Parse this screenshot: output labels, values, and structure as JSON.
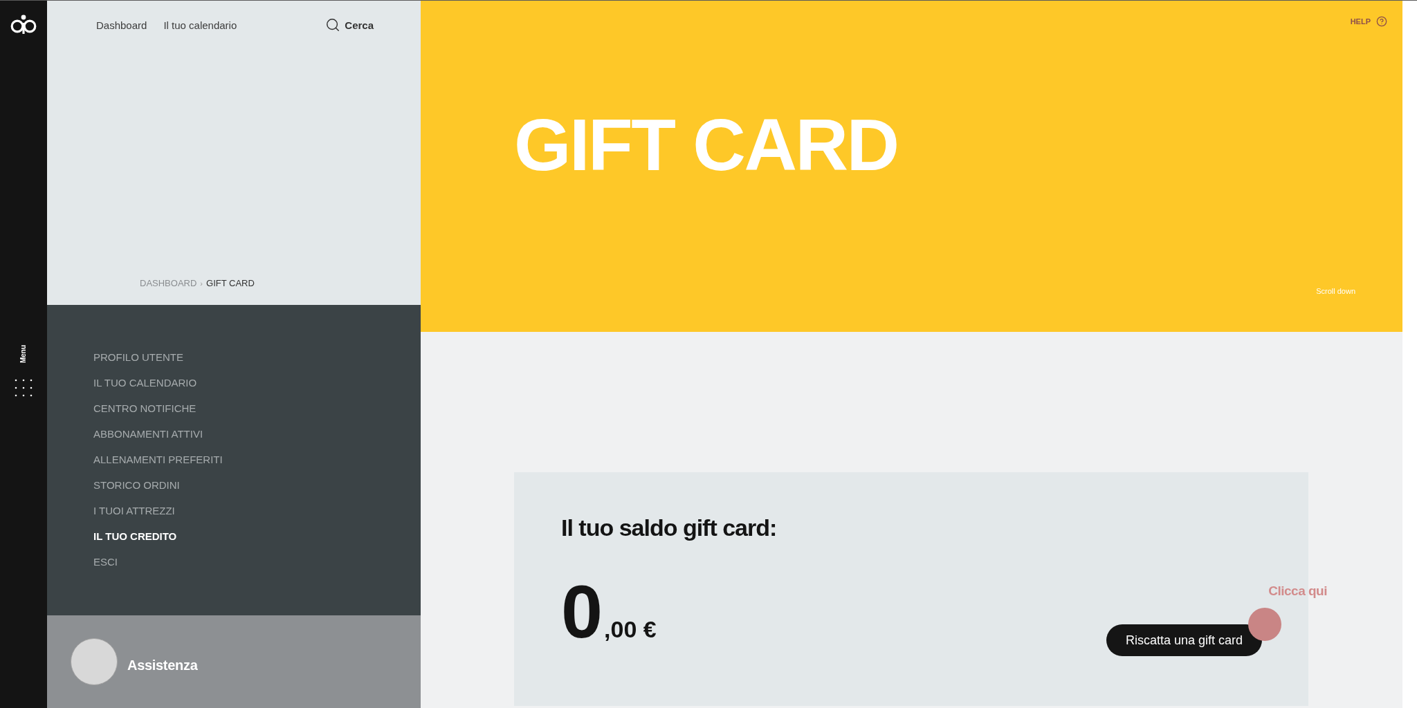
{
  "rail": {
    "menu_label": "Menu"
  },
  "top_nav": {
    "links": [
      {
        "label": "Dashboard"
      },
      {
        "label": "Il tuo calendario"
      }
    ],
    "search": {
      "label": "Cerca"
    }
  },
  "breadcrumb": {
    "separator": "›",
    "items": [
      {
        "label": "DASHBOARD",
        "current": false
      },
      {
        "label": "GIFT CARD",
        "current": true
      }
    ]
  },
  "menu": [
    {
      "label": "PROFILO UTENTE",
      "selected": false
    },
    {
      "label": "IL TUO CALENDARIO",
      "selected": false
    },
    {
      "label": "CENTRO NOTIFICHE",
      "selected": false
    },
    {
      "label": "ABBONAMENTI ATTIVI",
      "selected": false
    },
    {
      "label": "ALLENAMENTI PREFERITI",
      "selected": false
    },
    {
      "label": "STORICO ORDINI",
      "selected": false
    },
    {
      "label": "I TUOI ATTREZZI",
      "selected": false
    },
    {
      "label": "IL TUO CREDITO",
      "selected": true
    },
    {
      "label": "ESCI",
      "selected": false
    }
  ],
  "assistance": {
    "label": "Assistenza"
  },
  "hero": {
    "help": "HELP",
    "title": "GIFT CARD",
    "scroll_hint": "Scroll down"
  },
  "balance_card": {
    "heading": "Il tuo saldo gift card:",
    "amount_integer": "0",
    "amount_decimal": ",00 €",
    "redeem_button": "Riscatta una gift card",
    "hint": "Clicca qui"
  }
}
